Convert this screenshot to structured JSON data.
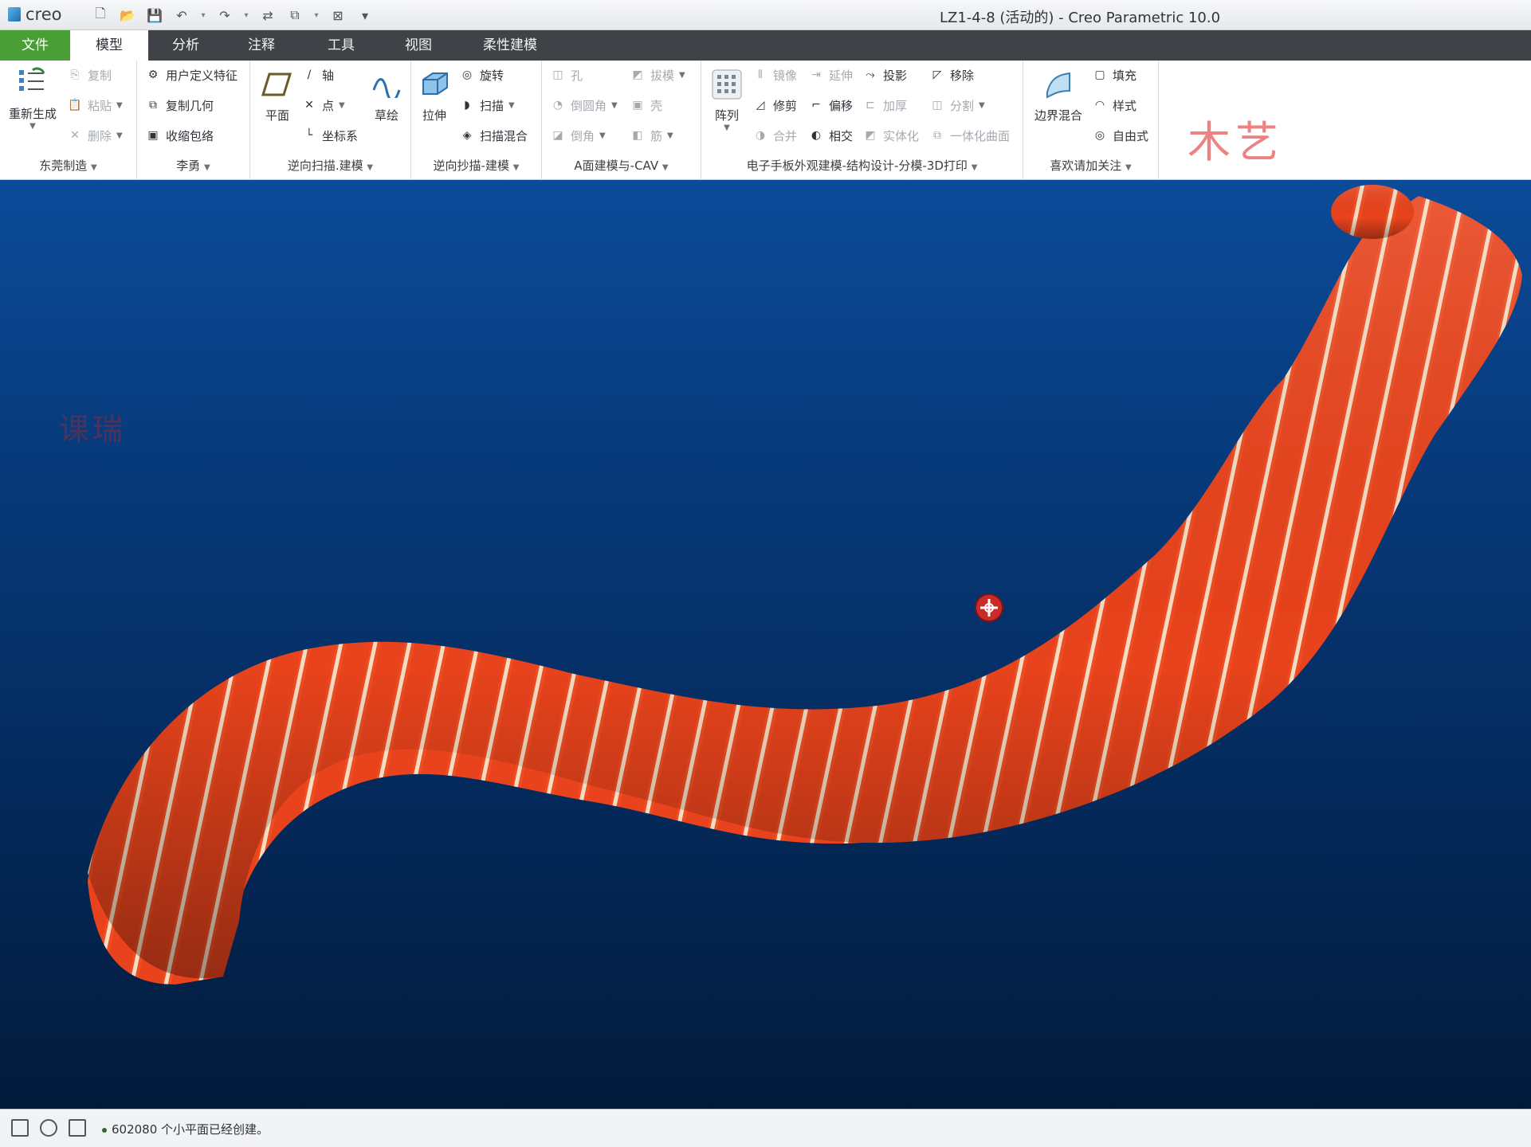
{
  "titlebar": {
    "logo": "creo",
    "window_title": "LZ1-4-8 (活动的) - Creo Parametric 10.0"
  },
  "menu": {
    "tabs": [
      "文件",
      "模型",
      "分析",
      "注释",
      "工具",
      "视图",
      "柔性建模"
    ]
  },
  "ribbon": {
    "groups": [
      {
        "label": "东莞制造",
        "regenerate": "重新生成",
        "copy": "复制",
        "paste": "粘贴",
        "delete": "删除"
      },
      {
        "label": "李勇",
        "udf": "用户定义特征",
        "copy_geom": "复制几何",
        "shrinkwrap": "收缩包络"
      },
      {
        "label": "逆向扫描.建模",
        "plane": "平面",
        "axis": "轴",
        "point": "点",
        "csys": "坐标系",
        "sketch": "草绘"
      },
      {
        "label": "逆向抄描-建模",
        "extrude": "拉伸",
        "revolve": "旋转",
        "sweep": "扫描",
        "swept_blend": "扫描混合"
      },
      {
        "label": "A面建模与-CAV",
        "hole": "孔",
        "draft": "拔模",
        "round": "倒圆角",
        "shell": "壳",
        "chamfer": "倒角",
        "rib": "筋"
      },
      {
        "label": "电子手板外观建模-结构设计-分模-3D打印",
        "pattern": "阵列",
        "mirror": "镜像",
        "extend": "延伸",
        "project": "投影",
        "remove": "移除",
        "trim": "修剪",
        "offset": "偏移",
        "thicken": "加厚",
        "split": "分割",
        "merge": "合并",
        "intersect": "相交",
        "solidify": "实体化",
        "unify": "一体化曲面"
      },
      {
        "label": "喜欢请加关注",
        "boundary_blend": "边界混合",
        "fill": "填充",
        "style": "样式",
        "freestyle": "自由式"
      }
    ],
    "watermark": "木艺"
  },
  "viewport": {
    "watermark": "课瑞"
  },
  "status": {
    "message": "602080 个小平面已经创建。"
  }
}
